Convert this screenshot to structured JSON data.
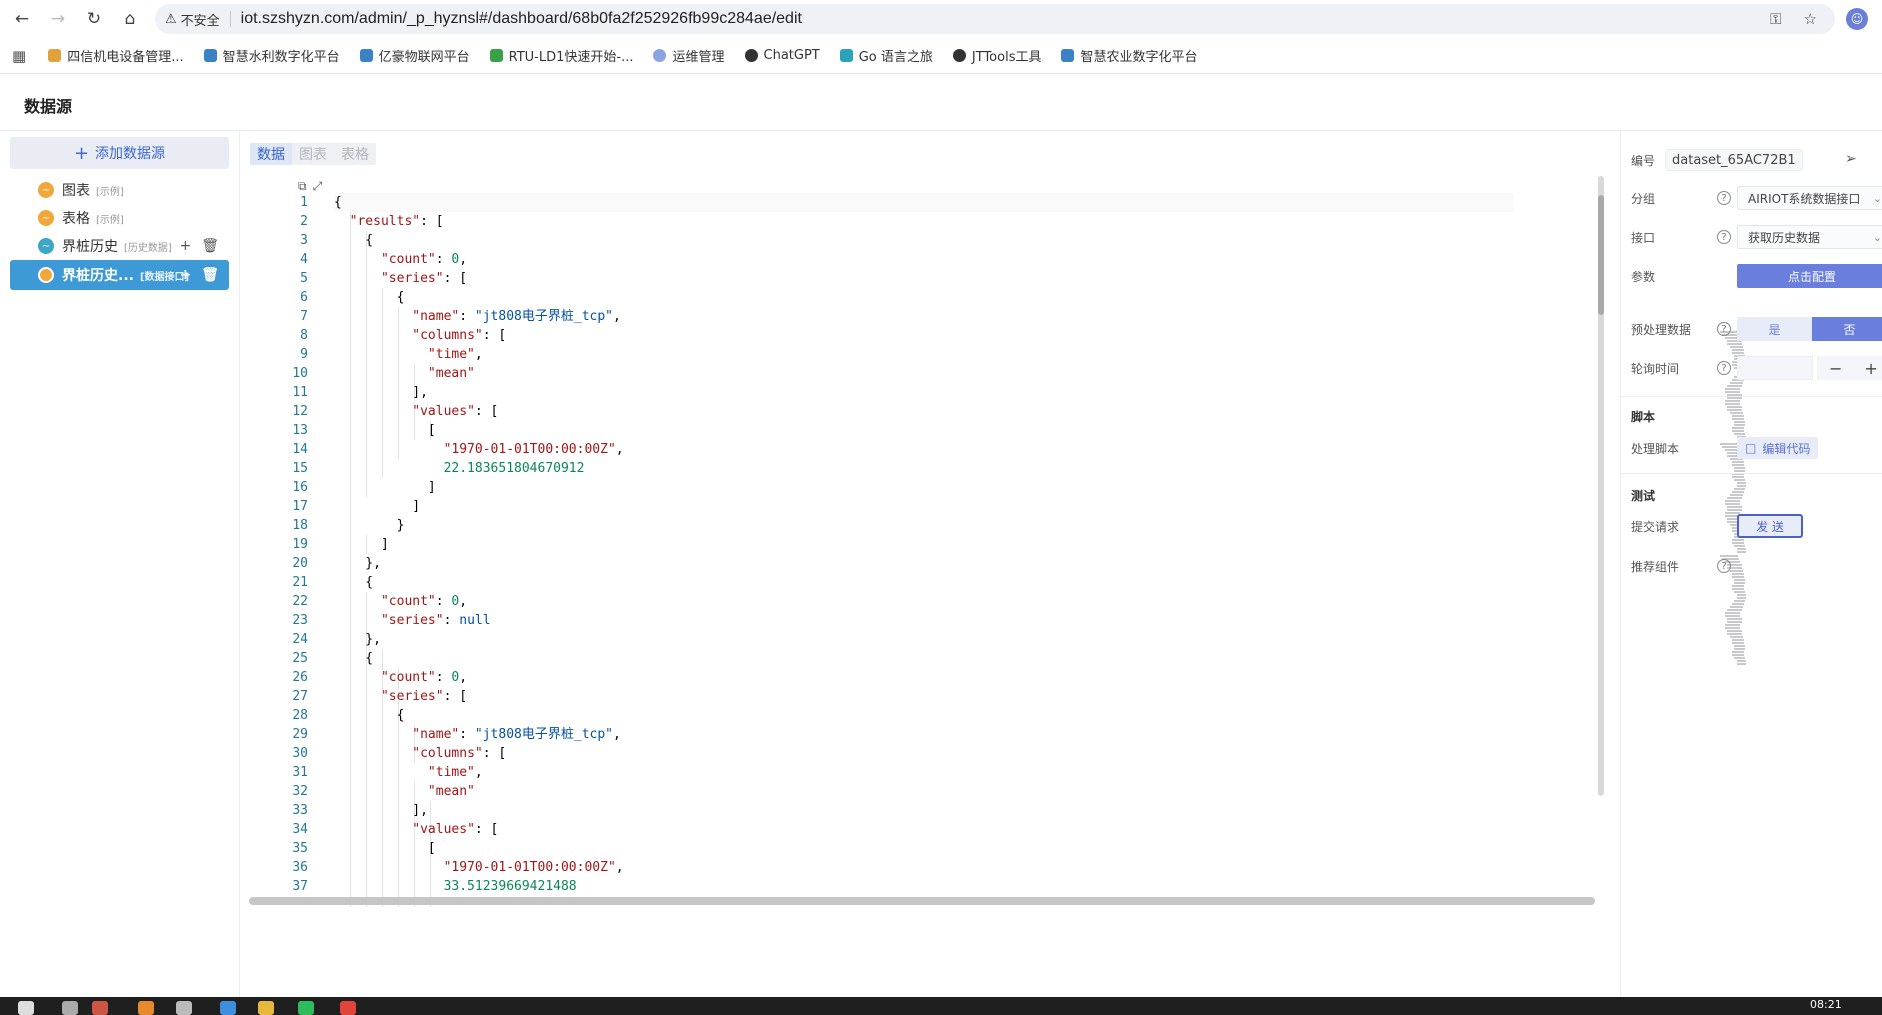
{
  "browser": {
    "security_label": "不安全",
    "url": "iot.szshyzn.com/admin/_p_hyznsl#/dashboard/68b0fa2f252926fb99c284ae/edit",
    "bookmarks": [
      {
        "label": "四信机电设备管理...",
        "color": "#e2a13a"
      },
      {
        "label": "智慧水利数字化平台",
        "color": "#3b82c4"
      },
      {
        "label": "亿豪物联网平台",
        "color": "#3b82c4"
      },
      {
        "label": "RTU-LD1快速开始-...",
        "color": "#3aa04a"
      },
      {
        "label": "运维管理",
        "color": "#8aa4e0"
      },
      {
        "label": "ChatGPT",
        "color": "#333333"
      },
      {
        "label": "Go 语言之旅",
        "color": "#2aa3b8"
      },
      {
        "label": "JTTools工具",
        "color": "#333333"
      },
      {
        "label": "智慧农业数字化平台",
        "color": "#3b82c4"
      }
    ]
  },
  "app": {
    "title": "数据源"
  },
  "sidebar": {
    "add_label": "添加数据源",
    "items": [
      {
        "label": "图表",
        "tag": "[示例]"
      },
      {
        "label": "表格",
        "tag": "[示例]"
      },
      {
        "label": "界桩历史",
        "tag": "[历史数据]"
      },
      {
        "label": "界桩历史...",
        "tag": "[数据接口]"
      }
    ]
  },
  "tabs": [
    "数据",
    "图表",
    "表格"
  ],
  "editor": {
    "line_numbers": [
      "1",
      "2",
      "3",
      "4",
      "5",
      "6",
      "7",
      "8",
      "9",
      "10",
      "11",
      "12",
      "13",
      "14",
      "15",
      "16",
      "17",
      "18",
      "19",
      "20",
      "21",
      "22",
      "23",
      "24",
      "25",
      "26",
      "27",
      "28",
      "29",
      "30",
      "31",
      "32",
      "33",
      "34",
      "35",
      "36",
      "37"
    ]
  },
  "rightpanel": {
    "id_label": "编号",
    "id_value": "dataset_65AC72B1",
    "group_label": "分组",
    "group_value": "AIRIOT系统数据接口",
    "interface_label": "接口",
    "interface_value": "获取历史数据",
    "params_label": "参数",
    "params_button": "点击配置",
    "preprocess_label": "预处理数据",
    "preprocess_yes": "是",
    "preprocess_no": "否",
    "poll_label": "轮询时间",
    "script_section": "脚本",
    "script_label": "处理脚本",
    "edit_code": "编辑代码",
    "test_section": "测试",
    "submit_label": "提交请求",
    "send_button": "发 送",
    "recommend_label": "推荐组件"
  },
  "taskbar": {
    "time": "08:21"
  }
}
